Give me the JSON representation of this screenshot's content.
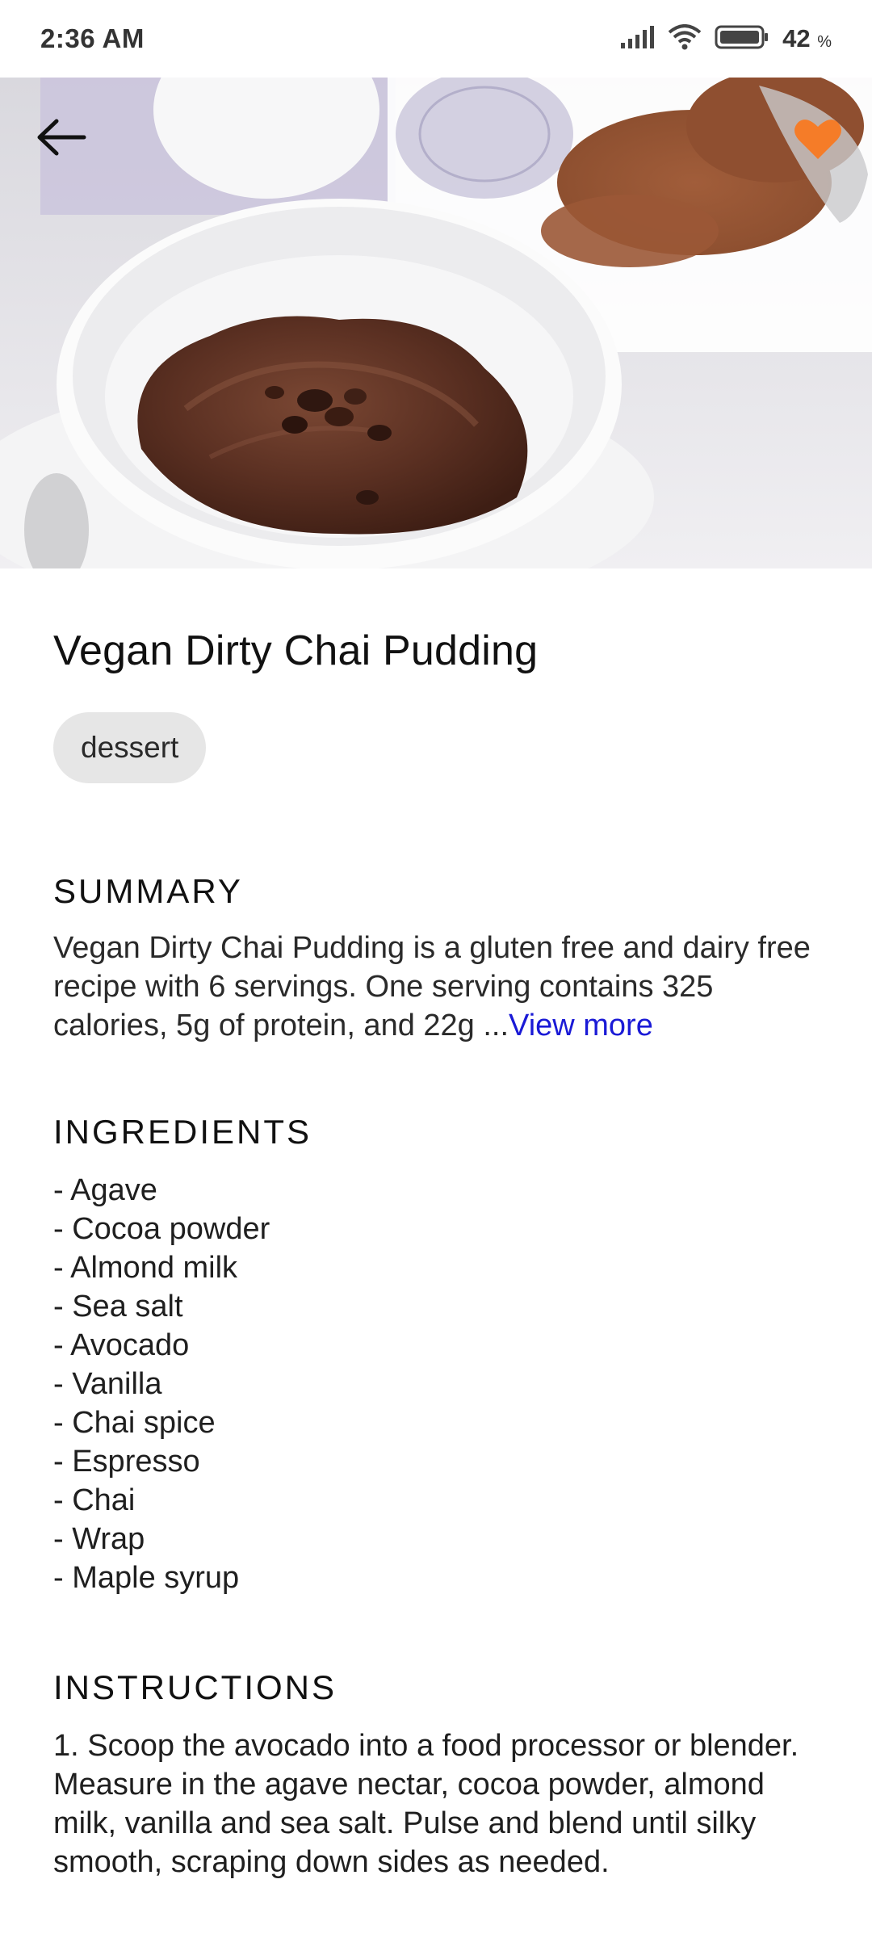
{
  "status_bar": {
    "time": "2:36 AM",
    "battery_level": "42",
    "battery_unit": "%"
  },
  "header": {
    "back_icon": "arrow-left-icon",
    "favorite_icon": "heart-icon",
    "favorite_color": "#F57C28",
    "image_subject": "chocolate pudding in white cup with cocoa powder"
  },
  "recipe": {
    "title": "Vegan Dirty Chai Pudding",
    "tags": [
      "dessert"
    ]
  },
  "summary": {
    "heading": "SUMMARY",
    "text": "Vegan Dirty Chai Pudding is a gluten free and dairy free recipe with 6 servings. One serving contains 325 calories, 5g of protein, and 22g ...",
    "view_more_label": "View more",
    "link_color": "#1A1AD6"
  },
  "ingredients": {
    "heading": "INGREDIENTS",
    "items": [
      "- Agave",
      "- Cocoa powder",
      "- Almond milk",
      "- Sea salt",
      "- Avocado",
      "- Vanilla",
      "- Chai spice",
      "- Espresso",
      "- Chai",
      "- Wrap",
      "- Maple syrup"
    ]
  },
  "instructions": {
    "heading": "INSTRUCTIONS",
    "text": "1. Scoop the avocado into a food processor or blender. Measure in the agave nectar, cocoa powder, almond milk, vanilla and sea salt. Pulse and blend until silky smooth, scraping down sides as needed."
  }
}
